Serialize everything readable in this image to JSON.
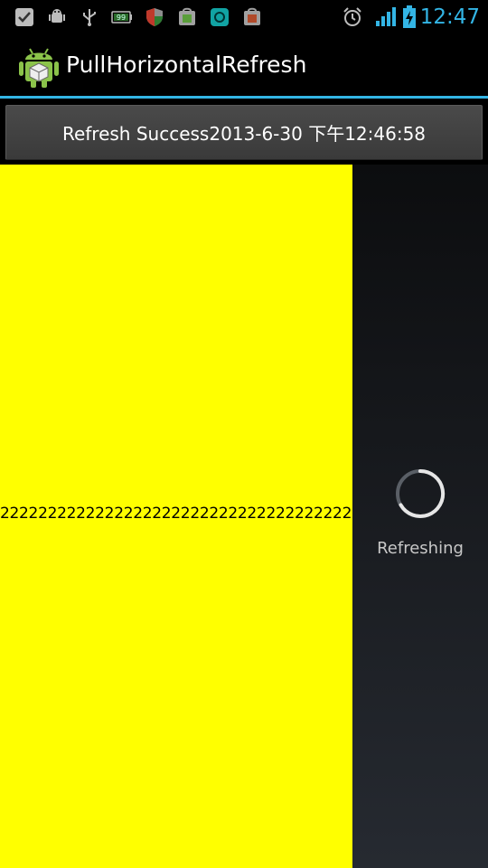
{
  "status_bar": {
    "time": "12:47",
    "notification_icons": [
      "check-icon",
      "android-debug-icon",
      "usb-icon",
      "battery-99-icon",
      "shield-icon",
      "app-store-icon",
      "camera-icon",
      "app-store-icon"
    ],
    "system_icons": [
      "alarm-icon",
      "signal-icon",
      "battery-charging-icon"
    ],
    "battery_label": "99"
  },
  "action_bar": {
    "title": "PullHorizontalRefresh"
  },
  "refresh_button": {
    "label": "Refresh Success2013-6-30 下午12:46:58"
  },
  "content_panel": {
    "text": "2222222222222222222222222222222222222222222222222",
    "background": "#ffff00"
  },
  "refresh_panel": {
    "label": "Refreshing"
  },
  "colors": {
    "accent": "#33b5e5",
    "yellow": "#ffff00"
  }
}
